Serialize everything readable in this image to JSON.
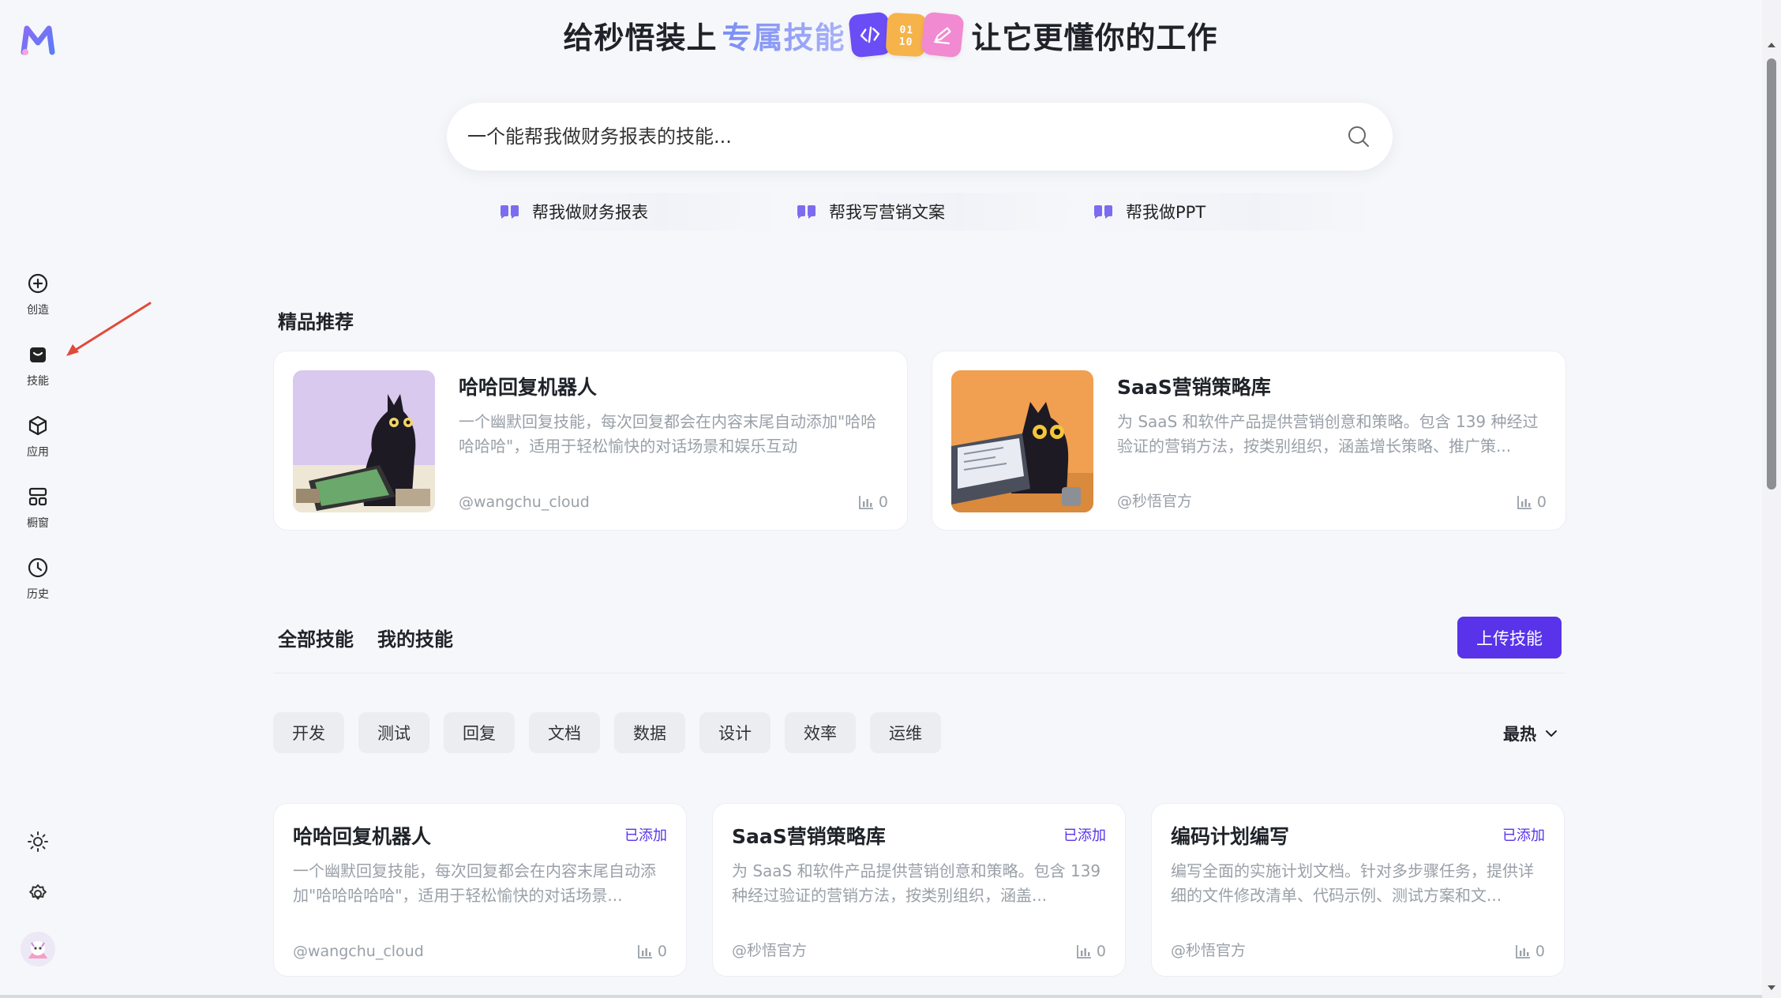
{
  "sidebar": {
    "logo_icon": "brand-logo-icon",
    "items": [
      {
        "label": "创造",
        "icon": "plus-circle-icon"
      },
      {
        "label": "技能",
        "icon": "skill-bag-icon"
      },
      {
        "label": "应用",
        "icon": "cube-icon"
      },
      {
        "label": "橱窗",
        "icon": "layout-grid-icon"
      },
      {
        "label": "历史",
        "icon": "clock-icon"
      }
    ],
    "bottom": [
      "sun-icon",
      "gear-icon",
      "avatar"
    ]
  },
  "hero": {
    "prefix": "给秒悟装上",
    "highlight": "专属技能",
    "badges": [
      "</>",
      "01\n10",
      "✎"
    ],
    "suffix": "让它更懂你的工作"
  },
  "search": {
    "placeholder": "一个能帮我做财务报表的技能..."
  },
  "suggestions": [
    "帮我做财务报表",
    "帮我写营销文案",
    "帮我做PPT"
  ],
  "featured": {
    "title": "精品推荐",
    "cards": [
      {
        "title": "哈哈回复机器人",
        "desc": "一个幽默回复技能，每次回复都会在内容末尾自动添加\"哈哈哈哈哈\"，适用于轻松愉快的对话场景和娱乐互动",
        "author": "@wangchu_cloud",
        "count": "0"
      },
      {
        "title": "SaaS营销策略库",
        "desc": "为 SaaS 和软件产品提供营销创意和策略。包含 139 种经过验证的营销方法，按类别组织，涵盖增长策略、推广策...",
        "author": "@秒悟官方",
        "count": "0"
      }
    ]
  },
  "tabs": [
    "全部技能",
    "我的技能"
  ],
  "upload_label": "上传技能",
  "chips": [
    "开发",
    "测试",
    "回复",
    "文档",
    "数据",
    "设计",
    "效率",
    "运维"
  ],
  "sort_label": "最热",
  "skills": [
    {
      "title": "哈哈回复机器人",
      "status": "已添加",
      "desc": "一个幽默回复技能，每次回复都会在内容末尾自动添加\"哈哈哈哈哈\"，适用于轻松愉快的对话场景...",
      "author": "@wangchu_cloud",
      "count": "0"
    },
    {
      "title": "SaaS营销策略库",
      "status": "已添加",
      "desc": "为 SaaS 和软件产品提供营销创意和策略。包含 139 种经过验证的营销方法，按类别组织，涵盖...",
      "author": "@秒悟官方",
      "count": "0"
    },
    {
      "title": "编码计划编写",
      "status": "已添加",
      "desc": "编写全面的实施计划文档。针对多步骤任务，提供详细的文件修改清单、代码示例、测试方案和文...",
      "author": "@秒悟官方",
      "count": "0"
    }
  ],
  "colors": {
    "accent": "#5833ea",
    "background": "#f6f7fa",
    "muted_text": "#9aa0a8"
  }
}
